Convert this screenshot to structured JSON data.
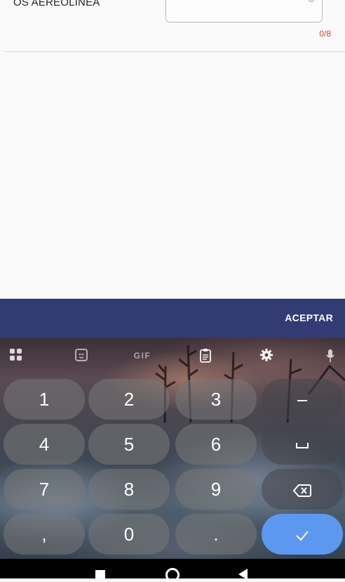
{
  "form": {
    "field_label": "OS AEREOLINEA",
    "field_value": "",
    "counter": "0/8"
  },
  "dialog": {
    "accept_label": "ACEPTAR"
  },
  "keyboard": {
    "toolbar": {
      "apps_icon": "grid-icon",
      "sticker_icon": "sticker-icon",
      "gif_label": "GIF",
      "clipboard_icon": "clipboard-icon",
      "settings_icon": "gear-icon",
      "mic_icon": "mic-icon"
    },
    "keys": {
      "k1": "1",
      "k2": "2",
      "k3": "3",
      "k4": "4",
      "k5": "5",
      "k6": "6",
      "k7": "7",
      "k8": "8",
      "k9": "9",
      "comma": ",",
      "k0": "0",
      "period": "."
    },
    "accent_color": "#5d98f0"
  },
  "navigation": {
    "recents_icon": "square-icon",
    "home_icon": "circle-icon",
    "back_icon": "triangle-back-icon"
  }
}
